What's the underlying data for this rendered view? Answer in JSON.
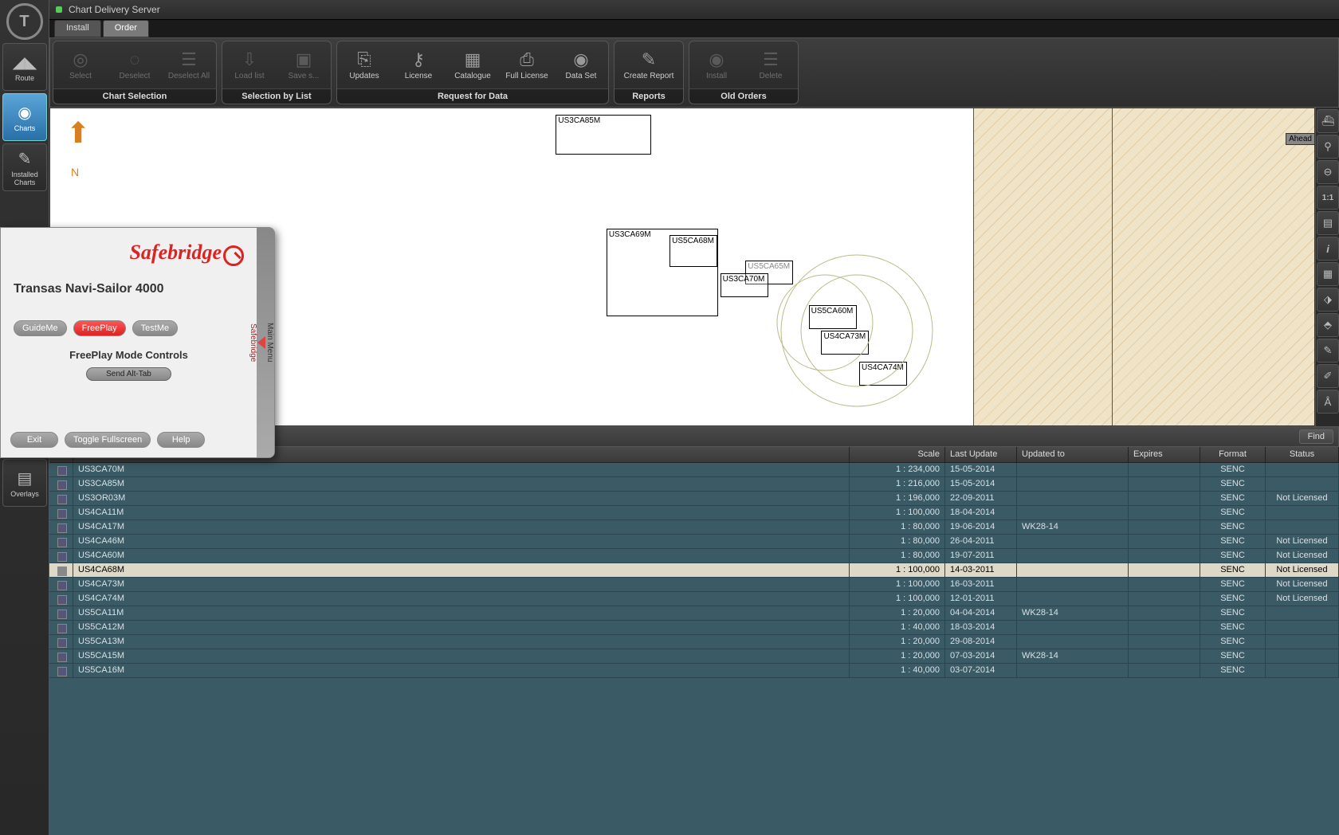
{
  "title": "Chart Delivery Server",
  "tabs": {
    "install": "Install",
    "order": "Order"
  },
  "sidebar": {
    "route": "Route",
    "charts": "Charts",
    "installed": "Installed\nCharts",
    "overlays": "Overlays"
  },
  "toolbar": {
    "groups": {
      "selection": {
        "label": "Chart Selection",
        "select": "Select",
        "deselect": "Deselect",
        "deselect_all": "Deselect All"
      },
      "list": {
        "label": "Selection by List",
        "load": "Load list",
        "save": "Save s..."
      },
      "request": {
        "label": "Request for Data",
        "updates": "Updates",
        "license": "License",
        "catalogue": "Catalogue",
        "full": "Full License",
        "dataset": "Data Set"
      },
      "reports": {
        "label": "Reports",
        "create": "Create Report"
      },
      "old": {
        "label": "Old Orders",
        "install": "Install",
        "delete": "Delete"
      }
    }
  },
  "right_tools": {
    "ahead": "Ahead",
    "ratio": "1:1"
  },
  "find": "Find",
  "map_labels": [
    "US3CA85M",
    "US3CA69M",
    "US5CA68M",
    "US5CA65M",
    "US3CA70M",
    "US5CA60M",
    "US4CA73M",
    "US4CA74M"
  ],
  "table": {
    "headers": {
      "scale": "Scale",
      "last_update": "Last Update",
      "updated_to": "Updated to",
      "expires": "Expires",
      "format": "Format",
      "status": "Status"
    },
    "rows": [
      {
        "name": "US3CA70M",
        "scale": "1 : 234,000",
        "last_update": "15-05-2014",
        "updated_to": "",
        "expires": "",
        "format": "SENC",
        "status": ""
      },
      {
        "name": "US3CA85M",
        "scale": "1 : 216,000",
        "last_update": "15-05-2014",
        "updated_to": "",
        "expires": "",
        "format": "SENC",
        "status": ""
      },
      {
        "name": "US3OR03M",
        "scale": "1 : 196,000",
        "last_update": "22-09-2011",
        "updated_to": "",
        "expires": "",
        "format": "SENC",
        "status": "Not Licensed"
      },
      {
        "name": "US4CA11M",
        "scale": "1 : 100,000",
        "last_update": "18-04-2014",
        "updated_to": "",
        "expires": "",
        "format": "SENC",
        "status": ""
      },
      {
        "name": "US4CA17M",
        "scale": "1 : 80,000",
        "last_update": "19-06-2014",
        "updated_to": "WK28-14",
        "expires": "",
        "format": "SENC",
        "status": ""
      },
      {
        "name": "US4CA46M",
        "scale": "1 : 80,000",
        "last_update": "26-04-2011",
        "updated_to": "",
        "expires": "",
        "format": "SENC",
        "status": "Not Licensed"
      },
      {
        "name": "US4CA60M",
        "scale": "1 : 80,000",
        "last_update": "19-07-2011",
        "updated_to": "",
        "expires": "",
        "format": "SENC",
        "status": "Not Licensed"
      },
      {
        "name": "US4CA68M",
        "scale": "1 : 100,000",
        "last_update": "14-03-2011",
        "updated_to": "",
        "expires": "",
        "format": "SENC",
        "status": "Not Licensed",
        "selected": true
      },
      {
        "name": "US4CA73M",
        "scale": "1 : 100,000",
        "last_update": "16-03-2011",
        "updated_to": "",
        "expires": "",
        "format": "SENC",
        "status": "Not Licensed"
      },
      {
        "name": "US4CA74M",
        "scale": "1 : 100,000",
        "last_update": "12-01-2011",
        "updated_to": "",
        "expires": "",
        "format": "SENC",
        "status": "Not Licensed"
      },
      {
        "name": "US5CA11M",
        "scale": "1 : 20,000",
        "last_update": "04-04-2014",
        "updated_to": "WK28-14",
        "expires": "",
        "format": "SENC",
        "status": ""
      },
      {
        "name": "US5CA12M",
        "scale": "1 : 40,000",
        "last_update": "18-03-2014",
        "updated_to": "",
        "expires": "",
        "format": "SENC",
        "status": ""
      },
      {
        "name": "US5CA13M",
        "scale": "1 : 20,000",
        "last_update": "29-08-2014",
        "updated_to": "",
        "expires": "",
        "format": "SENC",
        "status": ""
      },
      {
        "name": "US5CA15M",
        "scale": "1 : 20,000",
        "last_update": "07-03-2014",
        "updated_to": "WK28-14",
        "expires": "",
        "format": "SENC",
        "status": ""
      },
      {
        "name": "US5CA16M",
        "scale": "1 : 40,000",
        "last_update": "03-07-2014",
        "updated_to": "",
        "expires": "",
        "format": "SENC",
        "status": ""
      }
    ]
  },
  "popup": {
    "brand": "Safebridge",
    "title": "Transas Navi-Sailor 4000",
    "guideme": "GuideMe",
    "freeplay": "FreePlay",
    "testme": "TestMe",
    "mode_heading": "FreePlay Mode Controls",
    "send_alttab": "Send Alt-Tab",
    "exit": "Exit",
    "toggle_fs": "Toggle Fullscreen",
    "help": "Help",
    "side1": "Main Menu",
    "side2": "Safebridge"
  }
}
